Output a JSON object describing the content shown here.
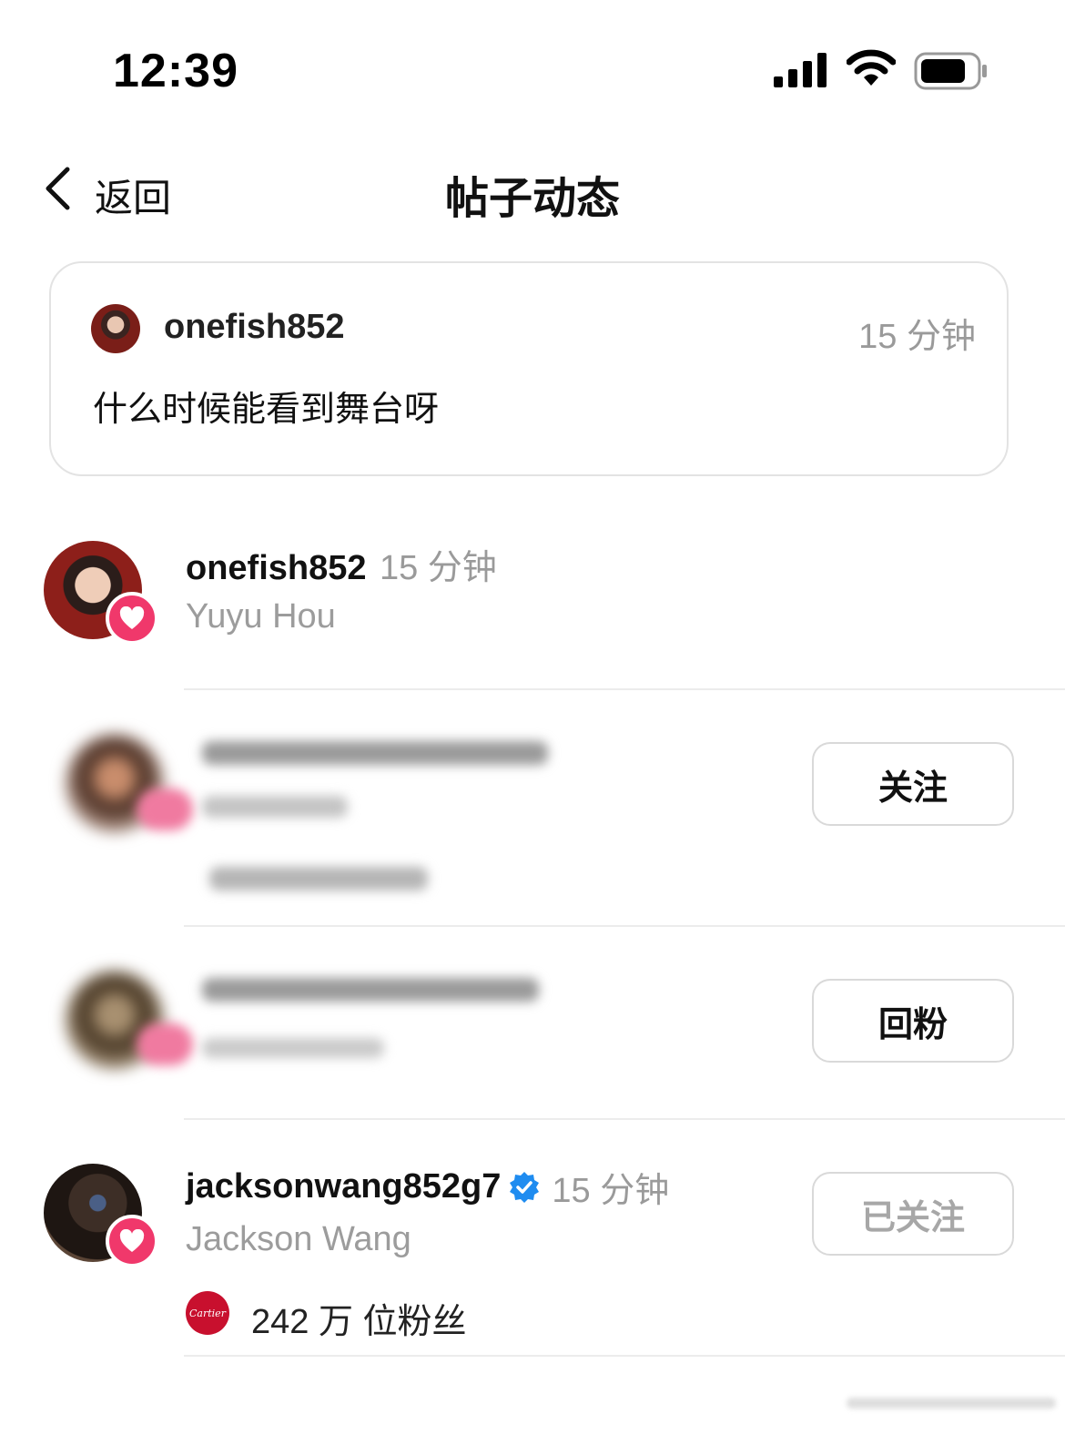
{
  "status_bar": {
    "time": "12:39"
  },
  "nav": {
    "back_label": "返回",
    "title": "帖子动态"
  },
  "post": {
    "username": "onefish852",
    "time": "15 分钟",
    "text": "什么时候能看到舞台呀"
  },
  "activity": [
    {
      "username": "onefish852",
      "time": "15 分钟",
      "display_name": "Yuyu Hou"
    },
    {
      "button": "关注"
    },
    {
      "button": "回粉"
    },
    {
      "username": "jacksonwang852g7",
      "time": "15 分钟",
      "display_name": "Jackson Wang",
      "button": "已关注",
      "verified": true,
      "brand": "Cartier",
      "followers": "242 万 位粉丝"
    }
  ],
  "colors": {
    "heart_badge": "#f0386b",
    "verified": "#1f8cf0",
    "muted_text": "#9a9a9a",
    "cartier": "#c8102e"
  },
  "icons": [
    "signal-icon",
    "wifi-icon",
    "battery-icon",
    "back-chevron-icon",
    "heart-icon",
    "verified-badge-icon"
  ]
}
